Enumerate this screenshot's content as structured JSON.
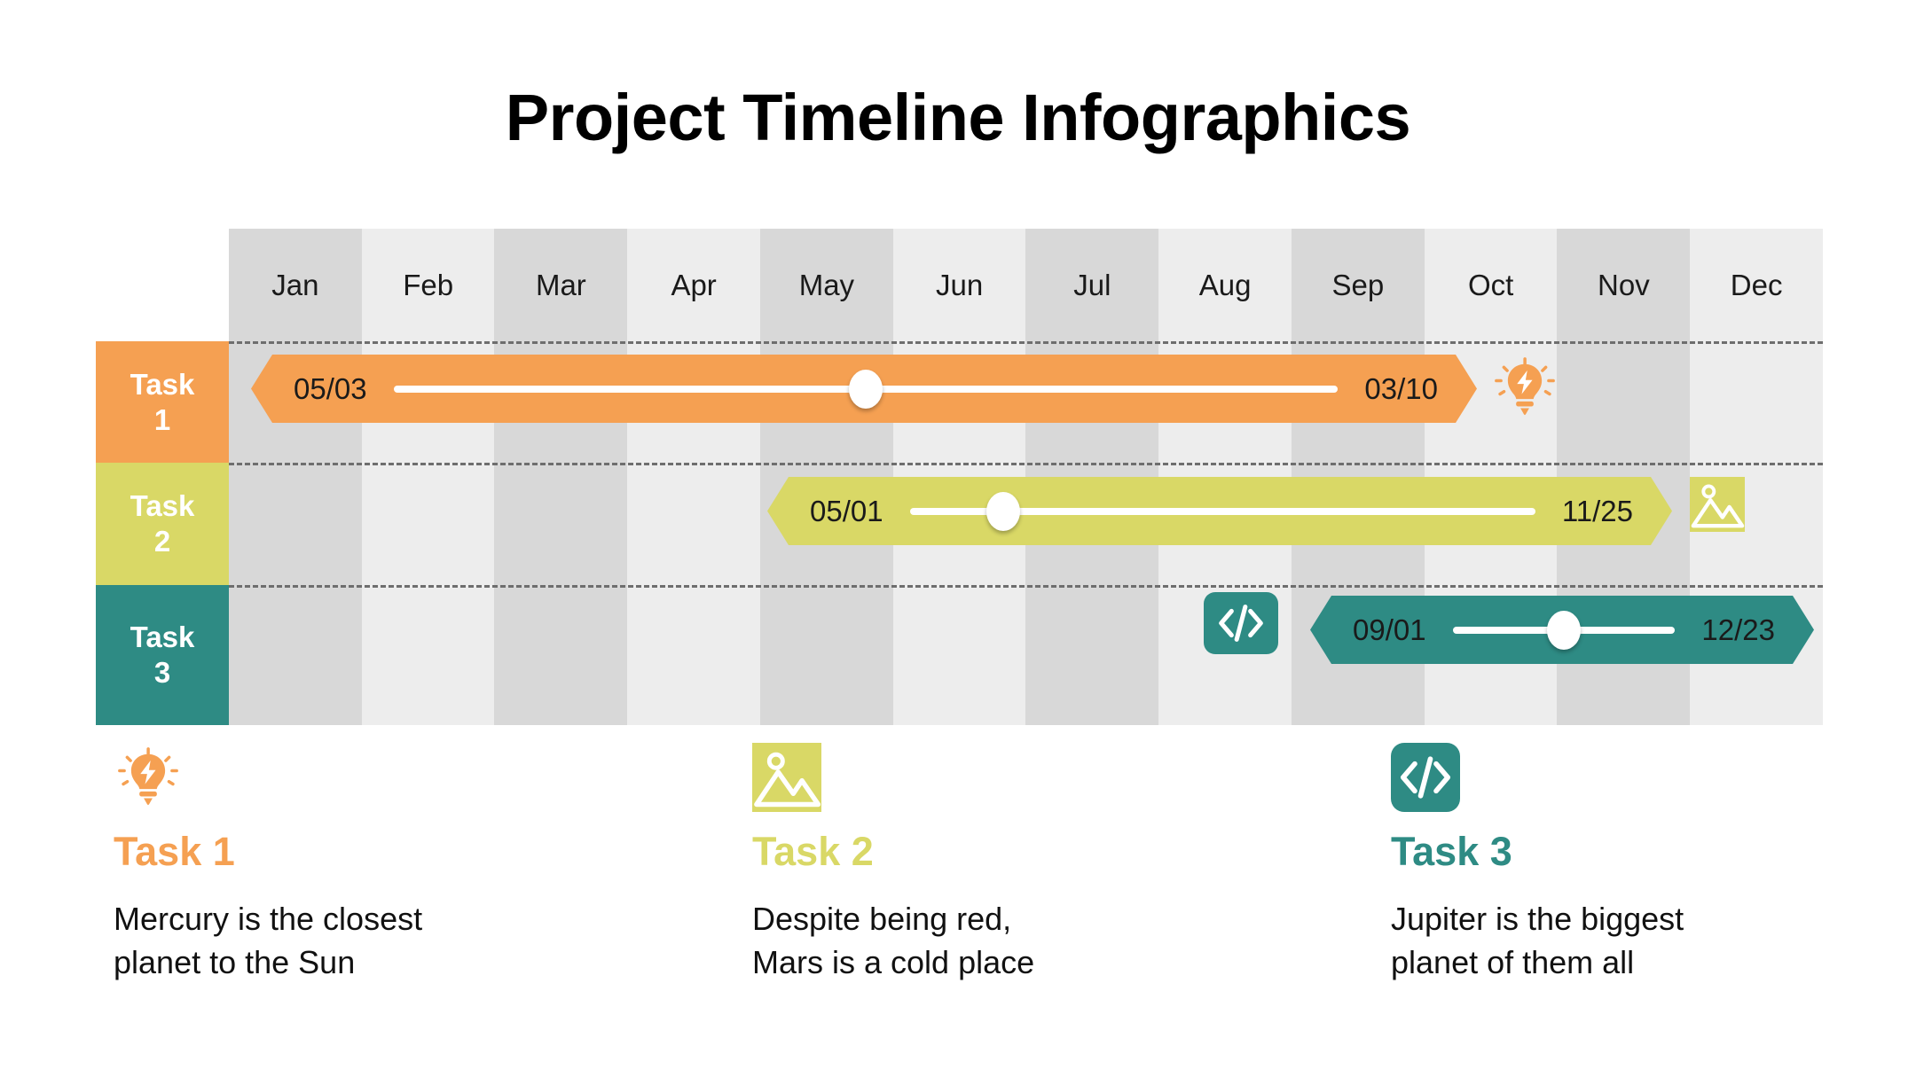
{
  "page": {
    "title": "Project Timeline Infographics",
    "background": "#FFFFFF"
  },
  "palette": {
    "task1": "#F5A052",
    "task2": "#D9D866",
    "task3": "#2E8B84",
    "stripe_dark": "#D8D8D8",
    "stripe_light": "#EDEDED",
    "dash_line": "#6E6E6E",
    "text_dark": "#111111",
    "white": "#FFFFFF"
  },
  "timeline": {
    "months": [
      "Jan",
      "Feb",
      "Mar",
      "Apr",
      "May",
      "Jun",
      "Jul",
      "Aug",
      "Sep",
      "Oct",
      "Nov",
      "Dec"
    ],
    "rows": [
      {
        "label_line1": "Task",
        "label_line2": "1",
        "color": "#F5A052",
        "start_date": "05/03",
        "end_date": "03/10",
        "progress_percent": 50,
        "icon": "lightbulb-bolt-icon",
        "icon_side": "right",
        "icon_style": "plain"
      },
      {
        "label_line1": "Task",
        "label_line2": "2",
        "color": "#D9D866",
        "start_date": "05/01",
        "end_date": "11/25",
        "progress_percent": 15,
        "icon": "image-mountain-icon",
        "icon_side": "right",
        "icon_style": "square"
      },
      {
        "label_line1": "Task",
        "label_line2": "3",
        "color": "#2E8B84",
        "start_date": "09/01",
        "end_date": "12/23",
        "progress_percent": 50,
        "icon": "code-brackets-icon",
        "icon_side": "left",
        "icon_style": "rounded"
      }
    ]
  },
  "legend": [
    {
      "icon": "lightbulb-bolt-icon",
      "icon_style": "plain",
      "title": "Task 1",
      "color": "#F5A052",
      "description": "Mercury is the closest\nplanet to the Sun"
    },
    {
      "icon": "image-mountain-icon",
      "icon_style": "square",
      "title": "Task 2",
      "color": "#D9D866",
      "description": "Despite being red,\nMars is a cold place"
    },
    {
      "icon": "code-brackets-icon",
      "icon_style": "rounded",
      "title": "Task 3",
      "color": "#2E8B84",
      "description": "Jupiter is the biggest\nplanet of them all"
    }
  ],
  "chart_data": {
    "type": "bar",
    "title": "Project Timeline Infographics",
    "xlabel": "",
    "ylabel": "",
    "categories": [
      "Task 1",
      "Task 2",
      "Task 3"
    ],
    "x_axis_ticks": [
      "Jan",
      "Feb",
      "Mar",
      "Apr",
      "May",
      "Jun",
      "Jul",
      "Aug",
      "Sep",
      "Oct",
      "Nov",
      "Dec"
    ],
    "grid": true,
    "legend_position": "bottom",
    "series": [
      {
        "name": "Task 1",
        "start_label": "05/03",
        "end_label": "03/10",
        "start_month_index": 0.18,
        "end_month_index": 9.4,
        "progress_percent": 50,
        "color": "#F5A052"
      },
      {
        "name": "Task 2",
        "start_label": "05/01",
        "end_label": "11/25",
        "start_month_index": 4.05,
        "end_month_index": 10.9,
        "progress_percent": 15,
        "color": "#D9D866"
      },
      {
        "name": "Task 3",
        "start_label": "09/01",
        "end_label": "12/23",
        "start_month_index": 8.4,
        "end_month_index": 12.0,
        "progress_percent": 50,
        "color": "#2E8B84"
      }
    ]
  }
}
